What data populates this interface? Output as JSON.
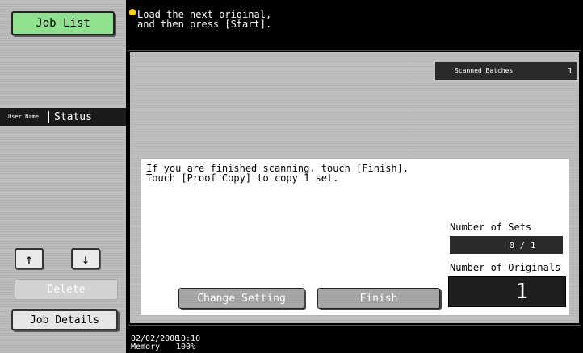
{
  "left": {
    "job_list": "Job List",
    "col_user": "User Name",
    "col_status": "Status",
    "up": "↑",
    "down": "↓",
    "delete": "Delete",
    "job_details": "Job Details"
  },
  "message": {
    "line1": "Load the next original,",
    "line2": "and then press [Start]."
  },
  "scanned": {
    "label": "Scanned Batches",
    "value": "1"
  },
  "info": {
    "line1": "If you are finished scanning, touch [Finish].",
    "line2": "Touch [Proof Copy] to copy 1 set."
  },
  "sets": {
    "label": "Number of Sets",
    "value": "0 / 1"
  },
  "originals": {
    "label": "Number of Originals",
    "value": "1"
  },
  "buttons": {
    "change_setting": "Change Setting",
    "finish": "Finish"
  },
  "status": {
    "date": "02/02/2008",
    "time": "10:10",
    "memory_label": "Memory",
    "memory_value": "100%"
  },
  "colors": {
    "job_list_bg": "#8fe08f",
    "bulb": "#ffd400"
  }
}
